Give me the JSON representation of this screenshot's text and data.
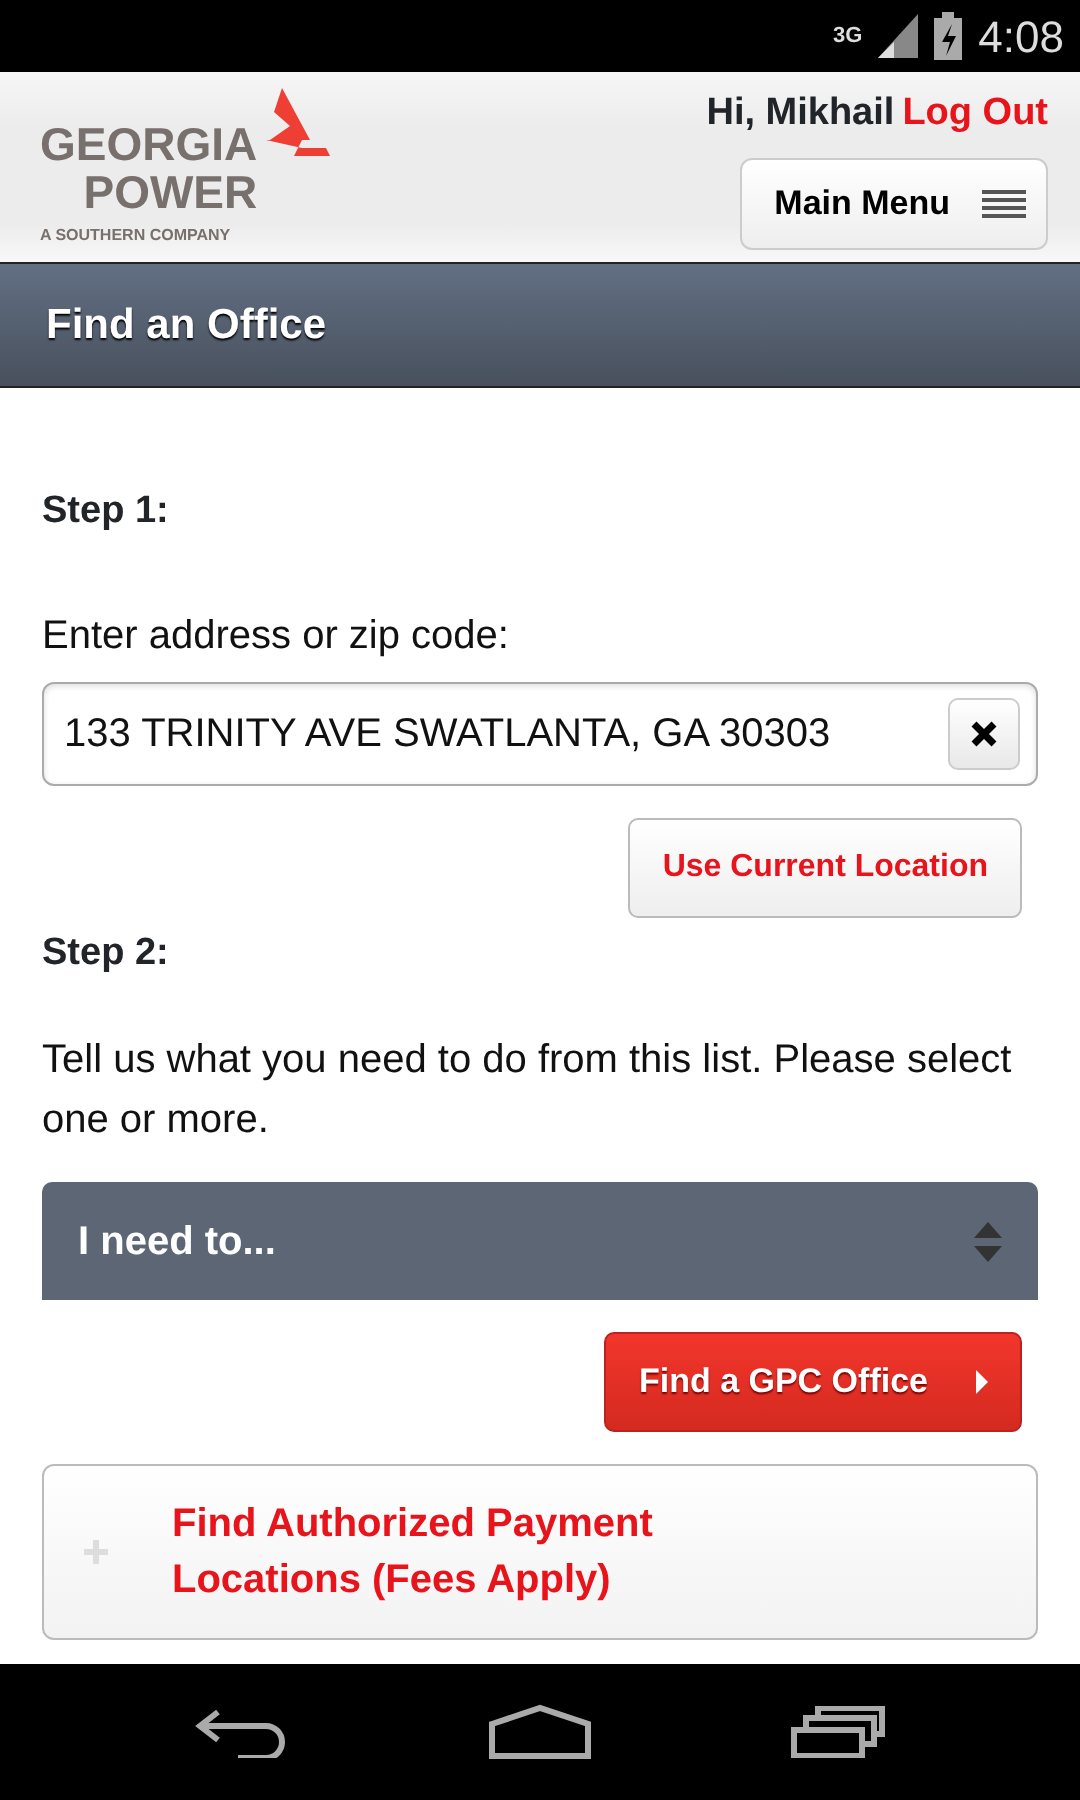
{
  "status_bar": {
    "network": "3G",
    "time": "4:08"
  },
  "header": {
    "logo": {
      "line1": "GEORGIA",
      "line2": "POWER",
      "tagline": "A SOUTHERN COMPANY"
    },
    "greeting": "Hi, Mikhail",
    "logout": "Log Out",
    "menu_button": "Main Menu"
  },
  "page_title": "Find an Office",
  "step1": {
    "heading": "Step 1:",
    "label": "Enter address or zip code:",
    "address_value": "133 TRINITY AVE SWATLANTA, GA 30303",
    "location_button": "Use Current Location"
  },
  "step2": {
    "heading": "Step 2:",
    "instructions": "Tell us what you need to do from this list. Please select one or more.",
    "select": "I need to...",
    "find_button": "Find a GPC Office"
  },
  "accordion": {
    "title": "Find Authorized Payment Locations (Fees Apply)",
    "expanded": false
  }
}
